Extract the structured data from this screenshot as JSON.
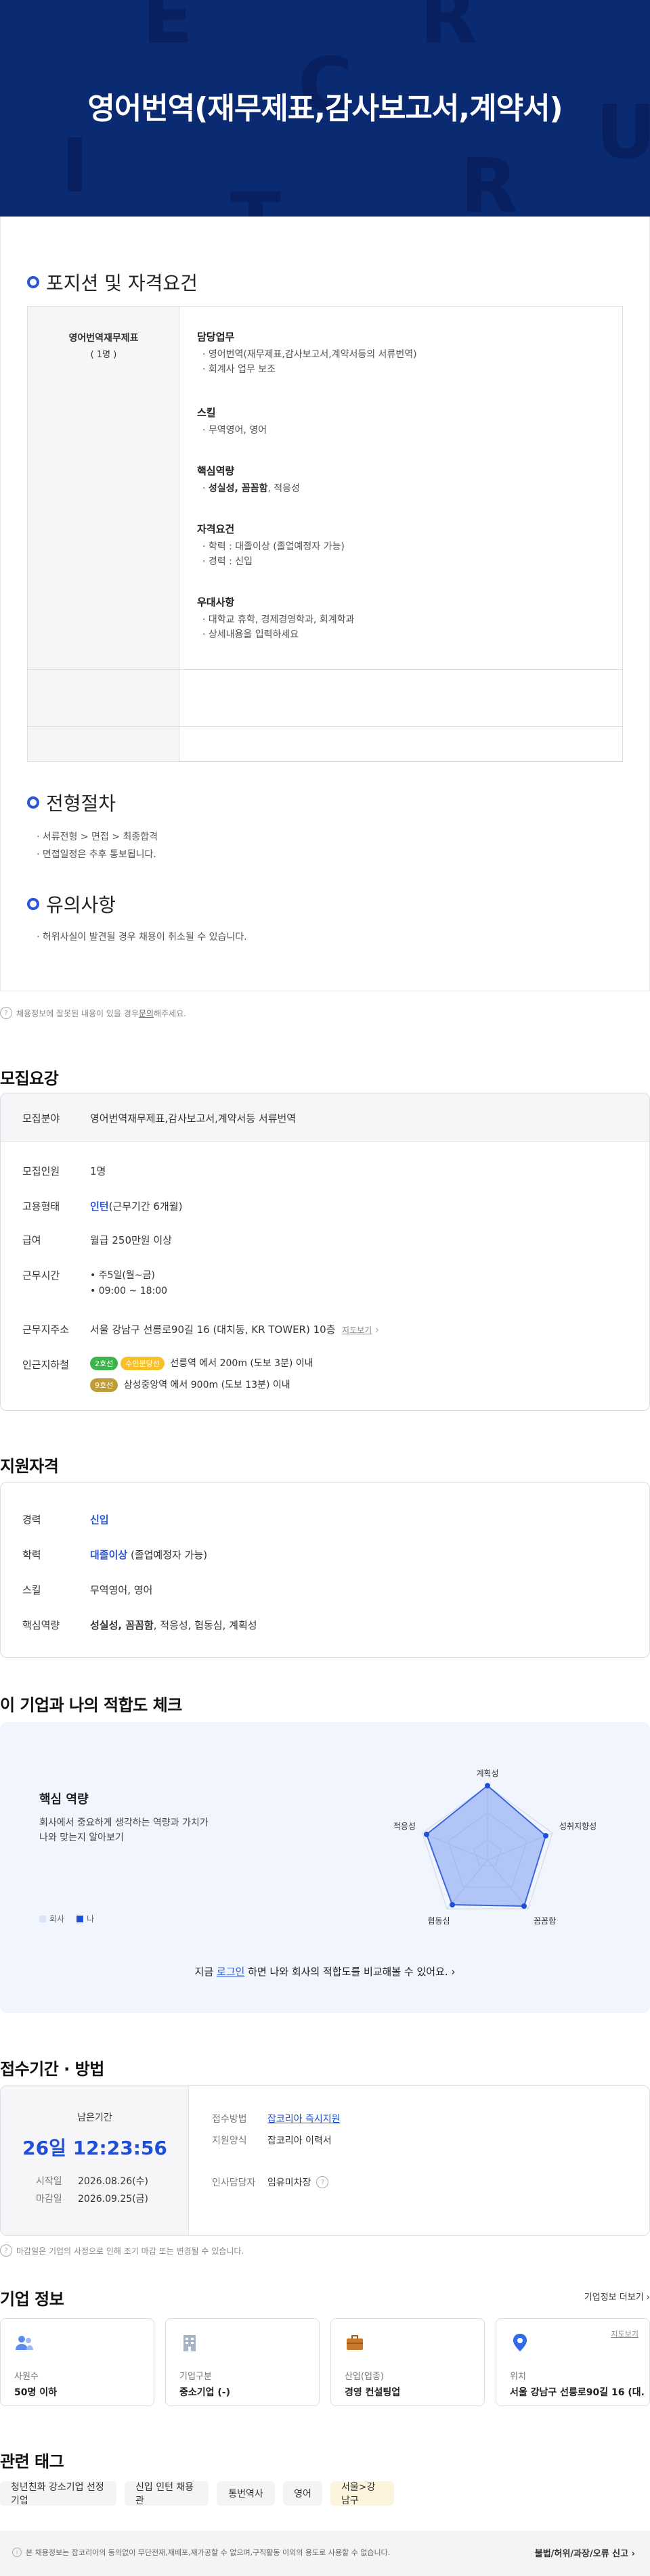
{
  "hero": {
    "bg_letters": [
      "E",
      "R",
      "C",
      "I",
      "R",
      "U",
      "T"
    ],
    "title": "영어번역(재무제표,감사보고서,계약서)"
  },
  "section_position": {
    "heading": "포지션 및 자격요건",
    "position_name": "영어번역재무제표",
    "position_count": "( 1명 )",
    "duties": {
      "label": "담당업무",
      "items": [
        "영어번역(재무제표,감사보고서,계약서등의 서류번역)",
        "회계사 업무 보조"
      ]
    },
    "skills": {
      "label": "스킬",
      "items": [
        "무역영어, 영어"
      ]
    },
    "competency": {
      "label": "핵심역량",
      "bold": "성실성, 꼼꼼함",
      "rest": ", 적응성"
    },
    "qualification": {
      "label": "자격요건",
      "items": [
        "학력 : 대졸이상 (졸업예정자 가능)",
        "경력 : 신입"
      ]
    },
    "preferred": {
      "label": "우대사항",
      "items": [
        "대학교 휴학, 경제경영학과, 회계학과",
        "상세내용을 입력하세요"
      ]
    }
  },
  "section_process": {
    "heading": "전형절차",
    "items": [
      "서류전형 > 면접 > 최종합격",
      "면접일정은 추후 통보됩니다."
    ]
  },
  "section_notice": {
    "heading": "유의사항",
    "items": [
      "허위사실이 발견될 경우 채용이 취소될 수 있습니다."
    ]
  },
  "report_note": {
    "before": "채용정보에 잘못된 내용이 있을 경우 ",
    "link": "문의",
    "after": "해주세요."
  },
  "recruit": {
    "heading": "모집요강",
    "field_label": "모집분야",
    "field_value": "영어번역재무제표,감사보고서,계약서등 서류번역",
    "count_label": "모집인원",
    "count_value": "1명",
    "type_label": "고용형태",
    "type_bold": "인턴",
    "type_rest": "(근무기간 6개월)",
    "pay_label": "급여",
    "pay_value": "월급 250만원 이상",
    "hours_label": "근무시간",
    "hours_items": [
      "주5일(월~금)",
      "09:00 ~ 18:00"
    ],
    "addr_label": "근무지주소",
    "addr_value": "서울 강남구 선릉로90길 16 (대치동, KR TOWER) 10층",
    "map_link": "지도보기",
    "station_label": "인근지하철",
    "stations": [
      {
        "badges": [
          "2호선",
          "수인분당선"
        ],
        "badge_colors": [
          "#3cb44a",
          "#f5c02a"
        ],
        "text": "선릉역 에서 200m (도보 3분) 이내"
      },
      {
        "badges": [
          "9호선"
        ],
        "badge_colors": [
          "#bf9c3a"
        ],
        "text": "삼성중앙역 에서 900m (도보 13분) 이내"
      }
    ]
  },
  "qualify": {
    "heading": "지원자격",
    "career_label": "경력",
    "career_value": "신입",
    "edu_label": "학력",
    "edu_bold": "대졸이상",
    "edu_rest": " (졸업예정자 가능)",
    "skill_label": "스킬",
    "skill_value": "무역영어, 영어",
    "comp_label": "핵심역량",
    "comp_bold": "성실성, 꼼꼼함",
    "comp_rest": ", 적응성, 협동심, 계획성"
  },
  "fit": {
    "heading": "이 기업과 나의 적합도 체크",
    "title": "핵심 역량",
    "desc": [
      "회사에서 중요하게 생각하는 역량과 가치가",
      "나와 맞는지 알아보기"
    ],
    "legend_company": "회사",
    "legend_me": "나",
    "axes": [
      "계획성",
      "성취지향성",
      "꼼꼼함",
      "협동심",
      "적응성"
    ],
    "login_before": "지금 ",
    "login_link": "로그인",
    "login_after": " 하면 나와 회사의 적합도를 비교해볼 수 있어요."
  },
  "apply": {
    "heading": "접수기간 · 방법",
    "remain_label": "남은기간",
    "remain_value": "26일 12:23:56",
    "start_label": "시작일",
    "start_value": "2026.08.26(수)",
    "end_label": "마감일",
    "end_value": "2026.09.25(금)",
    "method_label": "접수방법",
    "method_value": "잡코리아 즉시지원",
    "form_label": "지원양식",
    "form_value": "잡코리아 이력서",
    "manager_label": "인사담당자",
    "manager_value": "임유미차장",
    "note": "마감일은 기업의 사정으로 인해 조기 마감 또는 변경될 수 있습니다."
  },
  "company": {
    "heading": "기업 정보",
    "more": "기업정보 더보기",
    "cards": [
      {
        "label": "사원수",
        "value": "50명 이하"
      },
      {
        "label": "기업구분",
        "value": "중소기업 (-)"
      },
      {
        "label": "산업(업종)",
        "value": "경영 컨설팅업"
      },
      {
        "label": "위치",
        "value": "서울 강남구 선릉로90길 16 (대..."
      }
    ],
    "map_link": "지도보기"
  },
  "tags": {
    "heading": "관련 태그",
    "items": [
      "청년친화 강소기업 선정 기업",
      "신입 인턴 채용관",
      "통번역사",
      "영어",
      "서울>강남구"
    ]
  },
  "footer": {
    "text": "본 채용정보는 잡코리아의 동의없이 무단전재,재배포,재가공할 수 없으며,구직활동 이외의 용도로 사용할 수 없습니다.",
    "report": "불법/허위/과장/오류 신고"
  },
  "colors": {
    "hero": "#0a2a72",
    "accent": "#2a56d6",
    "panel_bg": "#f1f5fe"
  }
}
